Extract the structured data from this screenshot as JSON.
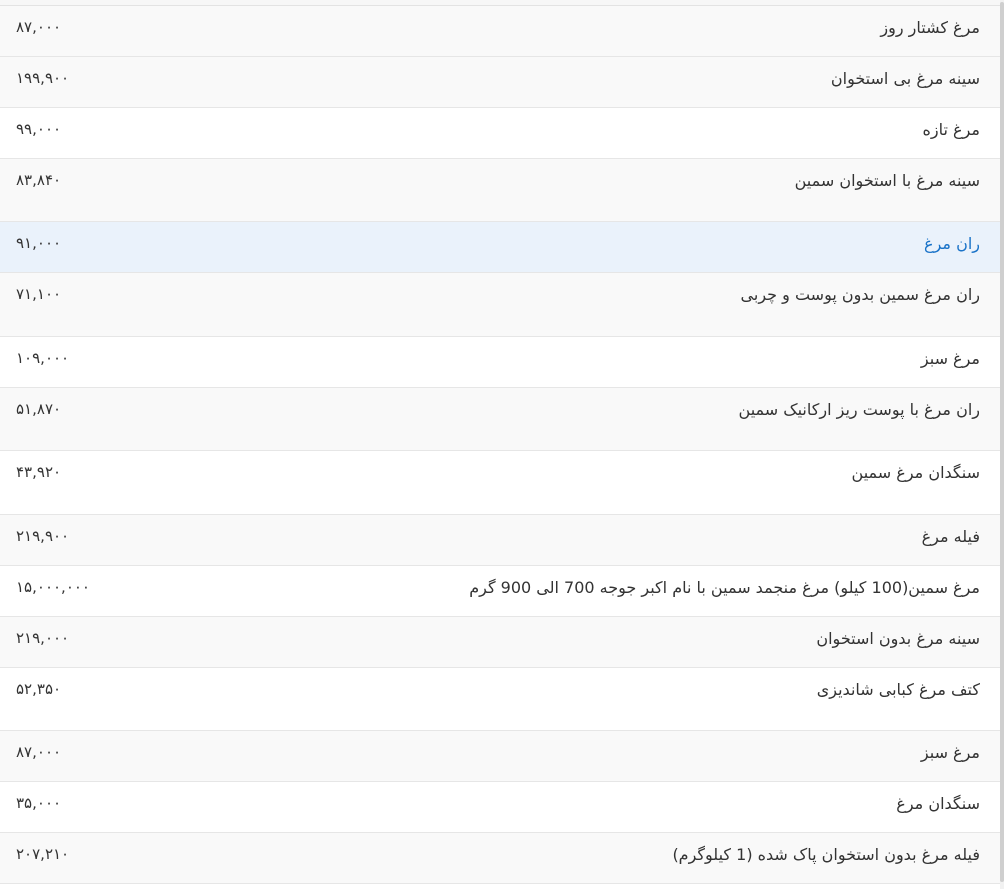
{
  "table": {
    "rows": [
      {
        "name": "مرغ کشتار روز",
        "price": "۸۷,۰۰۰"
      },
      {
        "name": "سینه مرغ بی استخوان",
        "price": "۱۹۹,۹۰۰"
      },
      {
        "name": "مرغ تازه",
        "price": "۹۹,۰۰۰"
      },
      {
        "name": "سینه مرغ با استخوان سمین",
        "price": "۸۳,۸۴۰"
      },
      {
        "name": "ران مرغ",
        "price": "۹۱,۰۰۰",
        "selected": true
      },
      {
        "name": "ران مرغ سمین بدون پوست و چربی",
        "price": "۷۱,۱۰۰"
      },
      {
        "name": "مرغ سبز",
        "price": "۱۰۹,۰۰۰"
      },
      {
        "name": "ران مرغ با پوست ریز ارکانیک سمین",
        "price": "۵۱,۸۷۰"
      },
      {
        "name": "سنگدان مرغ سمین",
        "price": "۴۳,۹۲۰"
      },
      {
        "name": "فیله مرغ",
        "price": "۲۱۹,۹۰۰"
      },
      {
        "name": "مرغ سمین(100 کیلو) مرغ منجمد سمین با نام اکبر جوجه 700 الی 900 گرم",
        "price": "۱۵,۰۰۰,۰۰۰"
      },
      {
        "name": "سینه مرغ بدون استخوان",
        "price": "۲۱۹,۰۰۰"
      },
      {
        "name": "کتف مرغ کبابی شاندیزی",
        "price": "۵۲,۳۵۰"
      },
      {
        "name": "مرغ سبز",
        "price": "۸۷,۰۰۰"
      },
      {
        "name": "سنگدان مرغ",
        "price": "۳۵,۰۰۰"
      },
      {
        "name": "فیله مرغ بدون استخوان پاک شده (1 کیلوگرم)",
        "price": "۲۰۷,۲۱۰"
      }
    ]
  }
}
